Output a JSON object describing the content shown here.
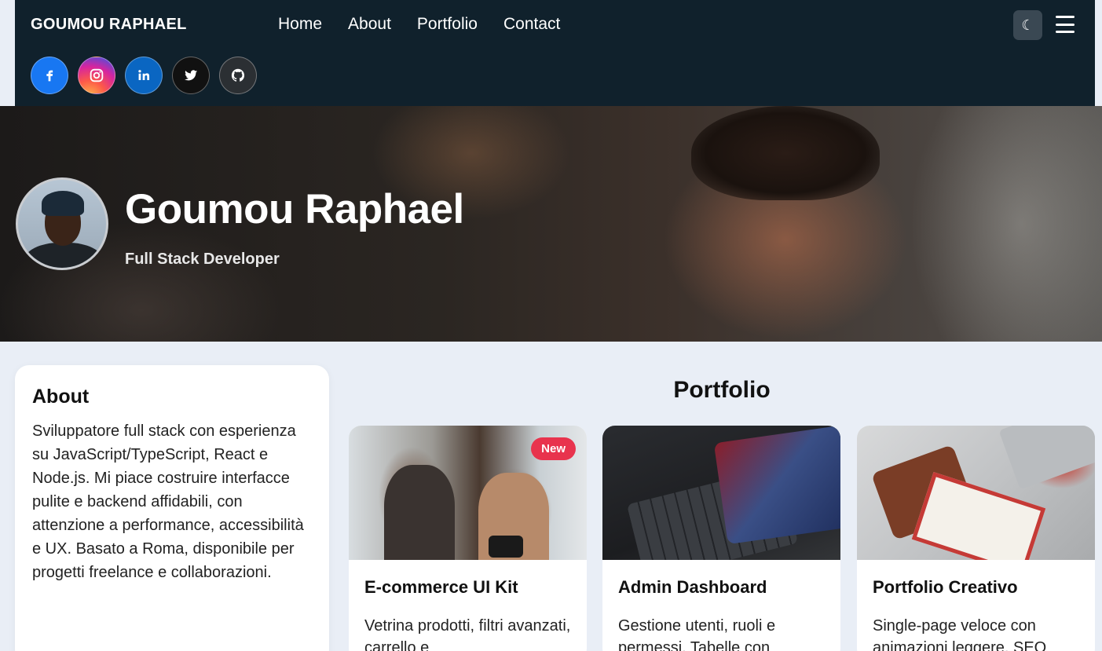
{
  "navbar": {
    "brand": "GOUMOU RAPHAEL",
    "links": [
      "Home",
      "About",
      "Portfolio",
      "Contact"
    ],
    "theme_toggle_icon": "moon-icon",
    "menu_icon": "hamburger-menu-icon",
    "socials": [
      {
        "name": "facebook",
        "icon": "facebook-icon",
        "color": "#1877f2"
      },
      {
        "name": "instagram",
        "icon": "instagram-icon",
        "color": "#d6249f"
      },
      {
        "name": "linkedin",
        "icon": "linkedin-icon",
        "color": "#0a66c2"
      },
      {
        "name": "twitter",
        "icon": "twitter-icon",
        "color": "#111111"
      },
      {
        "name": "github",
        "icon": "github-icon",
        "color": "#2b2f33"
      }
    ]
  },
  "hero": {
    "name": "Goumou Raphael",
    "role": "Full Stack Developer"
  },
  "about": {
    "title": "About",
    "text": "Sviluppatore full stack con esperienza su JavaScript/TypeScript, React e Node.js. Mi piace costruire interfacce pulite e backend affidabili, con attenzione a performance, accessibilità e UX. Basato a Roma, disponibile per progetti freelance e collaborazioni."
  },
  "portfolio": {
    "title": "Portfolio",
    "cards": [
      {
        "title": "E-commerce UI Kit",
        "desc": "Vetrina prodotti, filtri avanzati, carrello e",
        "badge": "New"
      },
      {
        "title": "Admin Dashboard",
        "desc": "Gestione utenti, ruoli e permessi. Tabelle con"
      },
      {
        "title": "Portfolio Creativo",
        "desc": "Single-page veloce con animazioni leggere. SEO"
      }
    ]
  },
  "colors": {
    "navbar_bg": "#10212c",
    "page_bg": "#e9eef6",
    "badge": "#e8334d"
  }
}
